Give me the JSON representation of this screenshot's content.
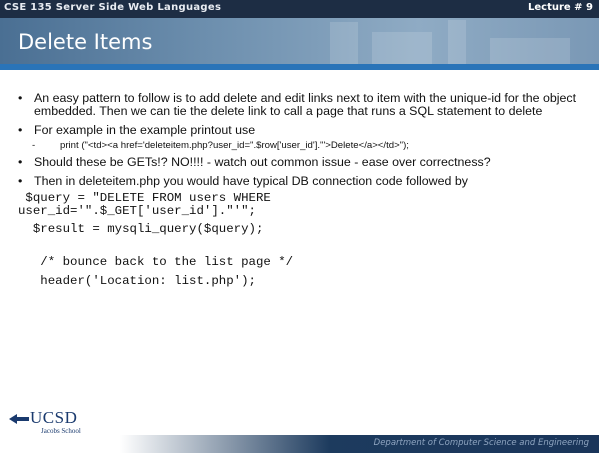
{
  "header": {
    "course": "CSE 135   Server Side Web Languages",
    "lecture": "Lecture # 9"
  },
  "title": "Delete Items",
  "bullets": {
    "b1": "An easy pattern to follow is to add delete and edit links next to item with the unique-id for the object embedded.  Then we can tie the delete link to call a page that runs a SQL statement to delete",
    "b2": "For example in the example printout use",
    "b2_sub_dash": "-",
    "b2_sub": "print (\"<td><a href='deleteitem.php?user_id=\".$row['user_id'].\"'>Delete</a></td>\");",
    "b3": "Should these be GETs!? NO!!!!  - watch out common issue - ease over correctness?",
    "b4": "Then in deleteitem.php you would have typical DB connection code followed by"
  },
  "code": {
    "line1": " $query = \"DELETE FROM users WHERE\nuser_id='\".$_GET['user_id'].\"'\";",
    "line2": "  $result = mysqli_query($query);",
    "line3": "   /* bounce back to the list page */",
    "line4": "   header('Location: list.php');"
  },
  "footer": {
    "department": "Department of Computer Science and Engineering",
    "logo_name": "UCSD",
    "logo_sub": "Jacobs School"
  }
}
